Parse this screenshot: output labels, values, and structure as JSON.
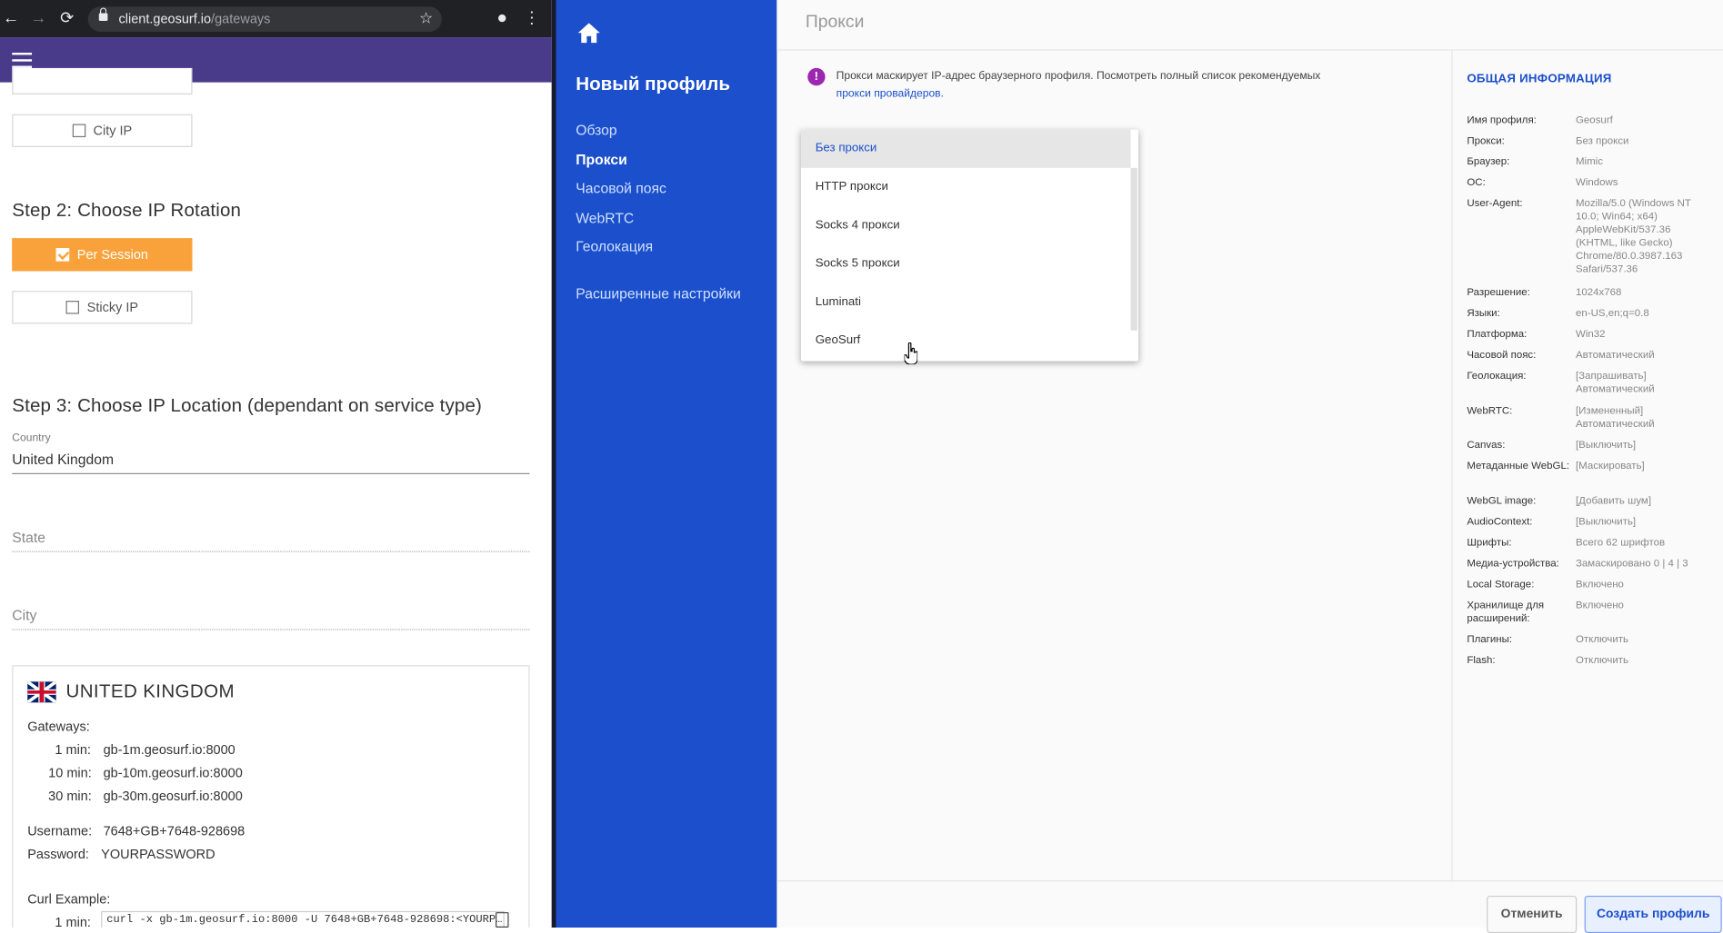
{
  "browser": {
    "url_host": "client.geosurf.io",
    "url_path": "/gateways"
  },
  "geosurf": {
    "options_top": {
      "city_ip": "City IP"
    },
    "step2": {
      "title": "Step 2: Choose IP Rotation",
      "per_session": "Per Session",
      "sticky_ip": "Sticky IP"
    },
    "step3": {
      "title": "Step 3: Choose IP Location (dependant on service type)",
      "country_label": "Country",
      "country_value": "United Kingdom",
      "state_placeholder": "State",
      "city_placeholder": "City"
    },
    "card": {
      "title": "UNITED KINGDOM",
      "gateways_label": "Gateways:",
      "gateways": [
        {
          "time": "1 min:",
          "host": "gb-1m.geosurf.io:8000"
        },
        {
          "time": "10 min:",
          "host": "gb-10m.geosurf.io:8000"
        },
        {
          "time": "30 min:",
          "host": "gb-30m.geosurf.io:8000"
        }
      ],
      "username_label": "Username:",
      "username": "7648+GB+7648-928698",
      "password_label": "Password:",
      "password": "YOURPASSWORD",
      "curl_label": "Curl Example:",
      "curl_time": "1 min:",
      "curl_cmd": "curl -x gb-1m.geosurf.io:8000 -U 7648+GB+7648-928698:<YOURP…"
    }
  },
  "app": {
    "sidebar": {
      "title": "Новый профиль",
      "items": [
        "Обзор",
        "Прокси",
        "Часовой пояс",
        "WebRTC",
        "Геолокация"
      ],
      "advanced": "Расширенные настройки",
      "active_index": 1
    },
    "header_title": "Прокси",
    "info": {
      "text": "Прокси маскирует IP-адрес браузерного профиля. Посмотреть полный список рекомендуемых",
      "link": "прокси провайдеров."
    },
    "dropdown": {
      "options": [
        "Без прокси",
        "HTTP прокси",
        "Socks 4 прокси",
        "Socks 5 прокси",
        "Luminati",
        "GeoSurf"
      ],
      "selected": "Без прокси"
    },
    "summary": {
      "title": "ОБЩАЯ ИНФОРМАЦИЯ",
      "rows": [
        {
          "key": "Имя профиля:",
          "value": "Geosurf"
        },
        {
          "key": "Прокси:",
          "value": "Без прокси"
        },
        {
          "key": "Браузер:",
          "value": "Mimic"
        },
        {
          "key": "ОС:",
          "value": "Windows"
        },
        {
          "key": "User-Agent:",
          "value": "Mozilla/5.0 (Windows NT 10.0; Win64; x64) AppleWebKit/537.36 (KHTML, like Gecko) Chrome/80.0.3987.163 Safari/537.36"
        },
        {
          "key": "Разрешение:",
          "value": "1024x768"
        },
        {
          "key": "Языки:",
          "value": "en-US,en;q=0.8"
        },
        {
          "key": "Платформа:",
          "value": "Win32"
        },
        {
          "key": "Часовой пояс:",
          "value": "Автоматический"
        },
        {
          "key": "Геолокация:",
          "value": "[Запрашивать] Автоматический"
        },
        {
          "key": "WebRTC:",
          "value": "[Измененный] Автоматический"
        },
        {
          "key": "Canvas:",
          "value": "[Выключить]"
        },
        {
          "key": "Метаданные WebGL:",
          "value": "[Маскировать]"
        },
        {
          "key": "WebGL image:",
          "value": "[Добавить шум]"
        },
        {
          "key": "AudioContext:",
          "value": "[Выключить]"
        },
        {
          "key": "Шрифты:",
          "value": "Всего 62 шрифтов"
        },
        {
          "key": "Медиа-устройства:",
          "value": "Замаскировано 0 | 4 | 3"
        },
        {
          "key": "Local Storage:",
          "value": "Включено"
        },
        {
          "key": "Хранилище для расширений:",
          "value": "Включено"
        },
        {
          "key": "Плагины:",
          "value": "Отключить"
        },
        {
          "key": "Flash:",
          "value": "Отключить"
        }
      ]
    },
    "buttons": {
      "cancel": "Отменить",
      "create": "Создать профиль"
    }
  },
  "colors": {
    "sidebar_bg": "#1b4fcb",
    "geosurf_header": "#4a3b8a",
    "accent_orange": "#f9a23b",
    "info_purple": "#9c27b0"
  }
}
